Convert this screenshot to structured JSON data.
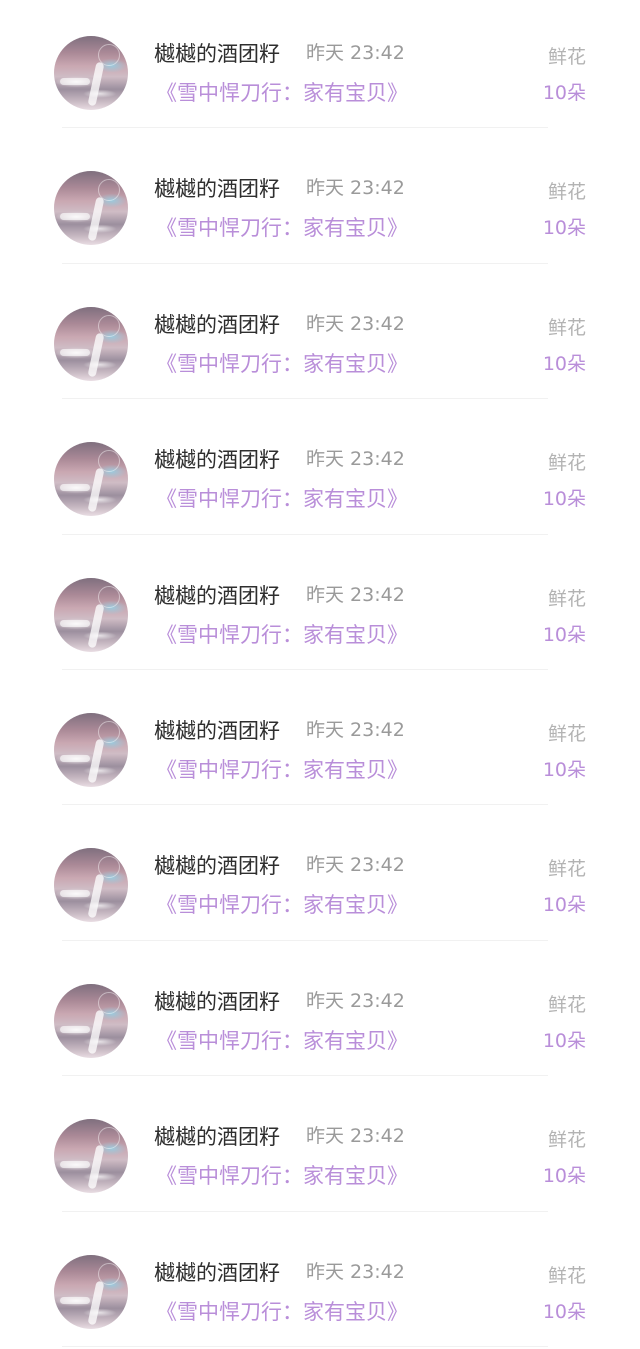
{
  "gifts": [
    {
      "user": "樾樾的酒团籽",
      "time": "昨天 23:42",
      "book": "《雪中悍刀行：家有宝贝》",
      "gift_type": "鲜花",
      "amount": "10朵"
    },
    {
      "user": "樾樾的酒团籽",
      "time": "昨天 23:42",
      "book": "《雪中悍刀行：家有宝贝》",
      "gift_type": "鲜花",
      "amount": "10朵"
    },
    {
      "user": "樾樾的酒团籽",
      "time": "昨天 23:42",
      "book": "《雪中悍刀行：家有宝贝》",
      "gift_type": "鲜花",
      "amount": "10朵"
    },
    {
      "user": "樾樾的酒团籽",
      "time": "昨天 23:42",
      "book": "《雪中悍刀行：家有宝贝》",
      "gift_type": "鲜花",
      "amount": "10朵"
    },
    {
      "user": "樾樾的酒团籽",
      "time": "昨天 23:42",
      "book": "《雪中悍刀行：家有宝贝》",
      "gift_type": "鲜花",
      "amount": "10朵"
    },
    {
      "user": "樾樾的酒团籽",
      "time": "昨天 23:42",
      "book": "《雪中悍刀行：家有宝贝》",
      "gift_type": "鲜花",
      "amount": "10朵"
    },
    {
      "user": "樾樾的酒团籽",
      "time": "昨天 23:42",
      "book": "《雪中悍刀行：家有宝贝》",
      "gift_type": "鲜花",
      "amount": "10朵"
    },
    {
      "user": "樾樾的酒团籽",
      "time": "昨天 23:42",
      "book": "《雪中悍刀行：家有宝贝》",
      "gift_type": "鲜花",
      "amount": "10朵"
    },
    {
      "user": "樾樾的酒团籽",
      "time": "昨天 23:42",
      "book": "《雪中悍刀行：家有宝贝》",
      "gift_type": "鲜花",
      "amount": "10朵"
    },
    {
      "user": "樾樾的酒团籽",
      "time": "昨天 23:42",
      "book": "《雪中悍刀行：家有宝贝》",
      "gift_type": "鲜花",
      "amount": "10朵"
    }
  ]
}
